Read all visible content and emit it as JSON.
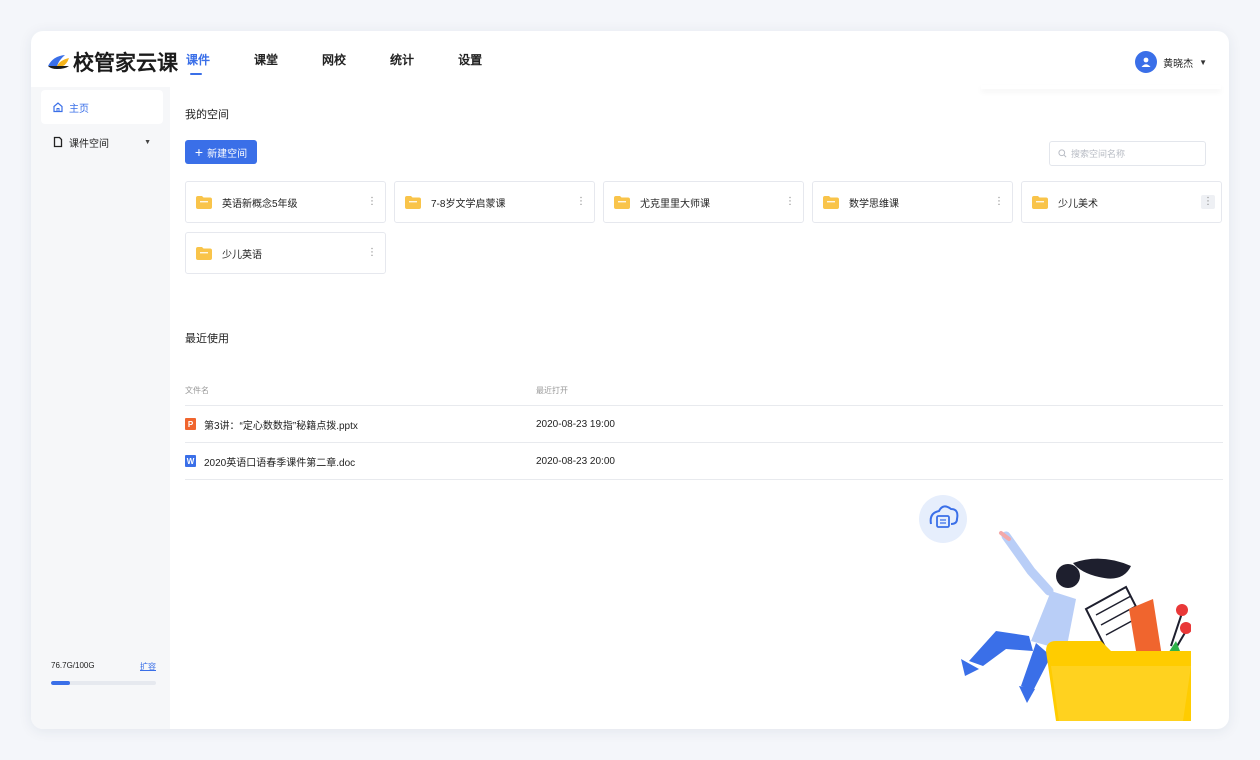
{
  "brand": {
    "name": "校管家云课"
  },
  "nav": {
    "tabs": [
      {
        "label": "课件",
        "active": true
      },
      {
        "label": "课堂",
        "active": false
      },
      {
        "label": "网校",
        "active": false
      },
      {
        "label": "统计",
        "active": false
      },
      {
        "label": "设置",
        "active": false
      }
    ]
  },
  "user": {
    "name": "黄晓杰",
    "icon": "user-icon"
  },
  "sidebar": {
    "items": [
      {
        "label": "主页",
        "icon": "home-icon",
        "active": true
      },
      {
        "label": "课件空间",
        "icon": "file-icon",
        "active": false
      }
    ],
    "storage": {
      "usage": "76.7G/100G",
      "used_fraction": 0.18,
      "expand_label": "扩容"
    }
  },
  "spaces": {
    "title": "我的空间",
    "new_button": "新建空间",
    "search_placeholder": "搜索空间名称",
    "items": [
      {
        "name": "英语新概念5年级"
      },
      {
        "name": "7-8岁文学启蒙课"
      },
      {
        "name": "尤克里里大师课"
      },
      {
        "name": "数学思维课"
      },
      {
        "name": "少儿美术"
      },
      {
        "name": "少儿英语"
      }
    ]
  },
  "recent": {
    "title": "最近使用",
    "columns": [
      "文件名",
      "最近打开"
    ],
    "rows": [
      {
        "name": "第3讲：“定心数数指”秘籍点拨.pptx",
        "opened": "2020-08-23  19:00",
        "type": "ppt",
        "icon_letter": "P"
      },
      {
        "name": "2020英语口语春季课件第二章.doc",
        "opened": "2020-08-23  20:00",
        "type": "doc",
        "icon_letter": "W"
      }
    ]
  },
  "colors": {
    "accent": "#3a6fe8",
    "folder": "#f9c44a",
    "ppt": "#f0652e",
    "illustration_folder": "#ffcc00"
  }
}
